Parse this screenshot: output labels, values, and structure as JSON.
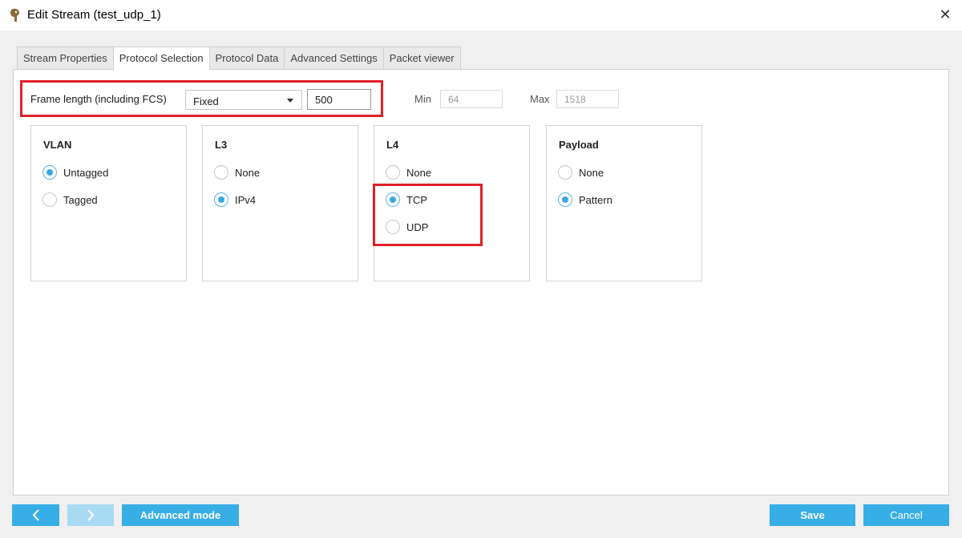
{
  "window": {
    "title": "Edit Stream (test_udp_1)"
  },
  "tabs": [
    {
      "label": "Stream Properties",
      "active": false
    },
    {
      "label": "Protocol Selection",
      "active": true
    },
    {
      "label": "Protocol Data",
      "active": false
    },
    {
      "label": "Advanced Settings",
      "active": false
    },
    {
      "label": "Packet viewer",
      "active": false
    }
  ],
  "frame_length": {
    "label": "Frame length (including FCS)",
    "mode": "Fixed",
    "value": "500",
    "min_label": "Min",
    "min_value": "64",
    "max_label": "Max",
    "max_value": "1518"
  },
  "groups": {
    "vlan": {
      "title": "VLAN",
      "options": [
        {
          "label": "Untagged",
          "checked": true
        },
        {
          "label": "Tagged",
          "checked": false
        }
      ]
    },
    "l3": {
      "title": "L3",
      "options": [
        {
          "label": "None",
          "checked": false
        },
        {
          "label": "IPv4",
          "checked": true
        }
      ]
    },
    "l4": {
      "title": "L4",
      "options": [
        {
          "label": "None",
          "checked": false
        },
        {
          "label": "TCP",
          "checked": true
        },
        {
          "label": "UDP",
          "checked": false
        }
      ]
    },
    "payload": {
      "title": "Payload",
      "options": [
        {
          "label": "None",
          "checked": false
        },
        {
          "label": "Pattern",
          "checked": true
        }
      ]
    }
  },
  "footer": {
    "advanced_mode_label": "Advanced mode",
    "save_label": "Save",
    "cancel_label": "Cancel"
  },
  "colors": {
    "accent": "#38aee6",
    "highlight": "#e0202a",
    "accent_disabled": "#a9daf3"
  },
  "icons": {
    "app": "app-icon",
    "close": "close-icon",
    "prev": "chevron-left-icon",
    "next": "chevron-right-icon",
    "dropdown": "caret-down-icon"
  }
}
